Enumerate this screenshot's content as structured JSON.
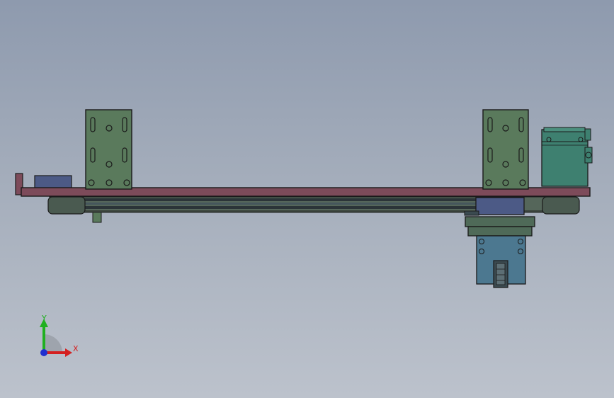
{
  "viewport": {
    "background_top": "#8e9aae",
    "background_bottom": "#bcc2cc"
  },
  "model": {
    "colors": {
      "base_plate": "#7d4b5a",
      "bracket": "#5a7a5c",
      "rail": "#3b4a50",
      "carriage": "#4f6a58",
      "motor": "#3e8070",
      "clamp": "#4c7890",
      "end_block": "#4c5a86"
    }
  },
  "triad": {
    "x_label": "X",
    "y_label": "Y",
    "x_color": "#d42020",
    "y_color": "#20b020",
    "z_color": "#2030d0",
    "icon": "view-orientation-triad-icon"
  }
}
